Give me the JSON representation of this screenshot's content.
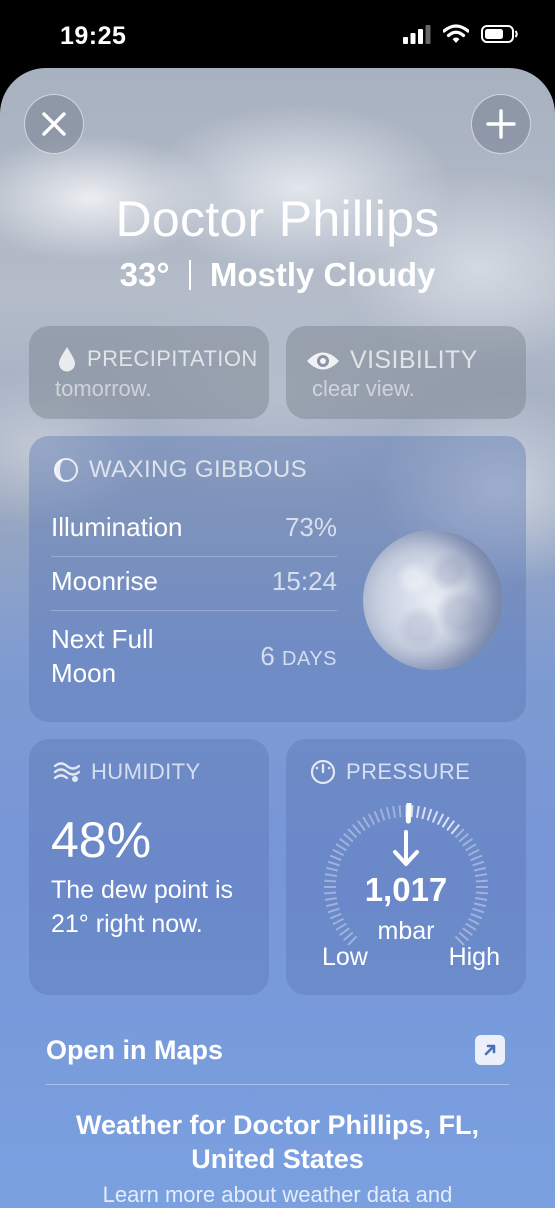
{
  "status": {
    "time": "19:25"
  },
  "header": {
    "city": "Doctor Phillips",
    "temperature": "33°",
    "condition": "Mostly Cloudy"
  },
  "cards": {
    "precipitation": {
      "title": "PRECIPITATION",
      "clipped_text": "tomorrow."
    },
    "visibility": {
      "title": "VISIBILITY",
      "clipped_text": "clear view."
    },
    "moon": {
      "title": "WAXING GIBBOUS",
      "rows": [
        {
          "label": "Illumination",
          "value": "73%"
        },
        {
          "label": "Moonrise",
          "value": "15:24"
        },
        {
          "label": "Next Full Moon",
          "value": "6",
          "unit": "DAYS"
        }
      ]
    },
    "humidity": {
      "title": "HUMIDITY",
      "value": "48%",
      "description": "The dew point is 21° right now."
    },
    "pressure": {
      "title": "PRESSURE",
      "value": "1,017",
      "unit": "mbar",
      "low_label": "Low",
      "high_label": "High",
      "trend": "falling"
    }
  },
  "footer": {
    "maps_label": "Open in Maps",
    "title": "Weather for Doctor Phillips, FL, United States",
    "subtitle": "Learn more about weather data and"
  },
  "icons": [
    "close-icon",
    "plus-icon",
    "droplet-icon",
    "eye-icon",
    "moon-phase-icon",
    "humidity-icon",
    "gauge-icon",
    "arrow-down-icon",
    "external-link-icon",
    "signal-icon",
    "wifi-icon",
    "battery-icon"
  ]
}
